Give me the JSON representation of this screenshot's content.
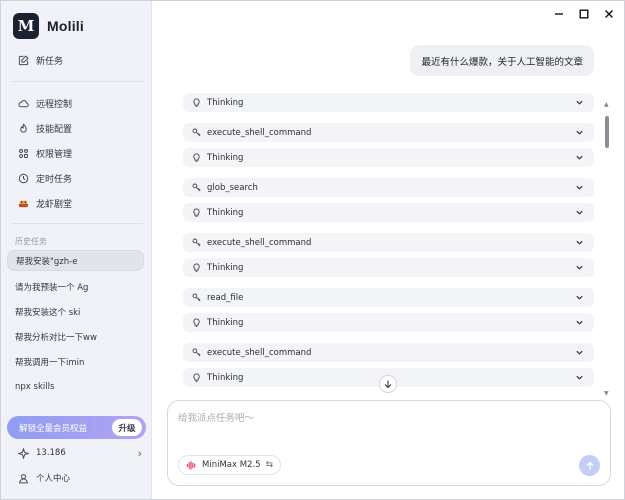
{
  "app": {
    "name": "Molili",
    "logo_text": "M"
  },
  "sidebar": {
    "new_task": "新任务",
    "nav": [
      {
        "label": "远程控制",
        "icon": "cloud-icon"
      },
      {
        "label": "技能配置",
        "icon": "flame-icon"
      },
      {
        "label": "权限管理",
        "icon": "grid-icon"
      },
      {
        "label": "定时任务",
        "icon": "clock-icon"
      },
      {
        "label": "龙虾剧堂",
        "icon": "lobster-icon"
      }
    ],
    "history_label": "历史任务",
    "history": [
      {
        "label": "帮我安装\"gzh-e"
      },
      {
        "label": "请为我预装一个 Ag"
      },
      {
        "label": "帮我安装这个 ski"
      },
      {
        "label": "帮我分析对比一下ww"
      },
      {
        "label": "帮我调用一下imin"
      },
      {
        "label": "npx skills"
      }
    ],
    "upgrade_label": "解锁全量会员权益",
    "upgrade_button": "升级",
    "credits": "13.186",
    "profile": "个人中心"
  },
  "chat": {
    "user_message": "最近有什么爆款，关于人工智能的文章",
    "steps": [
      {
        "label": "Thinking",
        "icon": "bulb-icon"
      },
      {
        "label": "execute_shell_command",
        "icon": "key-icon"
      },
      {
        "label": "Thinking",
        "icon": "bulb-icon"
      },
      {
        "label": "glob_search",
        "icon": "key-icon"
      },
      {
        "label": "Thinking",
        "icon": "bulb-icon"
      },
      {
        "label": "execute_shell_command",
        "icon": "key-icon"
      },
      {
        "label": "Thinking",
        "icon": "bulb-icon"
      },
      {
        "label": "read_file",
        "icon": "key-icon"
      },
      {
        "label": "Thinking",
        "icon": "bulb-icon"
      },
      {
        "label": "execute_shell_command",
        "icon": "key-icon"
      },
      {
        "label": "Thinking",
        "icon": "bulb-icon"
      }
    ]
  },
  "composer": {
    "placeholder": "给我派点任务吧～",
    "value": "",
    "model": "MiniMax M2.5"
  },
  "colors": {
    "sidebar_bg": "#f0f2f7",
    "accent_gradient_start": "#8f9df0",
    "accent_gradient_end": "#b3a3f2",
    "send_button": "#c4cdf4",
    "model_logo": "#e0405c"
  }
}
